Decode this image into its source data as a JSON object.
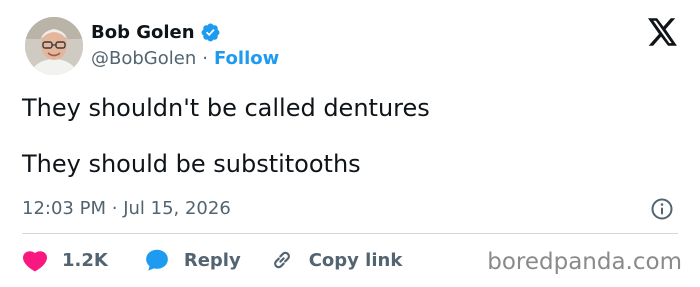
{
  "author": {
    "display_name": "Bob Golen",
    "handle": "@BobGolen",
    "follow_label": "Follow",
    "separator": "·",
    "verified": true
  },
  "tweet": {
    "lines": [
      "They shouldn't be called dentures",
      "They should be substitooths"
    ],
    "time": "12:03 PM",
    "date": "Jul 15, 2026",
    "meta_separator": "·"
  },
  "actions": {
    "likes": "1.2K",
    "reply_label": "Reply",
    "copy_link_label": "Copy link"
  },
  "watermark": "boredpanda.com",
  "colors": {
    "accent": "#1d9bf0",
    "like": "#f91880",
    "text": "#0f1419",
    "muted": "#536471",
    "divider": "#cfd9de"
  },
  "icons": [
    "verified-badge-icon",
    "x-logo-icon",
    "info-icon",
    "heart-icon",
    "reply-bubble-icon",
    "link-icon"
  ]
}
